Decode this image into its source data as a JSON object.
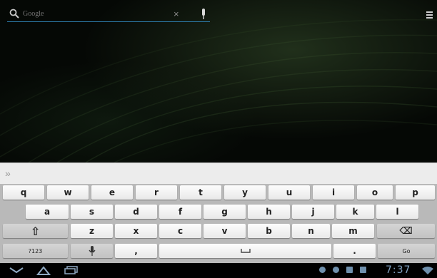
{
  "search": {
    "placeholder": "Google",
    "clear_glyph": "×"
  },
  "suggestions": {
    "expand_glyph": "»"
  },
  "keyboard": {
    "row1": [
      "q",
      "w",
      "e",
      "r",
      "t",
      "y",
      "u",
      "i",
      "o",
      "p"
    ],
    "row2": [
      "a",
      "s",
      "d",
      "f",
      "g",
      "h",
      "j",
      "k",
      "l"
    ],
    "row3": [
      "z",
      "x",
      "c",
      "v",
      "b",
      "n",
      "m"
    ],
    "shift_glyph": "⇧",
    "backspace_glyph": "⌫",
    "symbols_label": "?123",
    "comma_label": ",",
    "period_label": ".",
    "go_label": "Go"
  },
  "icons": {
    "search": "search-icon",
    "voice": "mic-icon",
    "menu": "menu-icon",
    "back": "back-icon",
    "home": "home-icon",
    "recents": "recent-apps-icon",
    "wifi": "wifi-icon"
  },
  "status_bar": {
    "time": "7:37"
  },
  "colors": {
    "status_accent": "#7fa0bf",
    "search_underline": "#2e7fb0",
    "keyboard_bg": "#b9b9b9"
  }
}
